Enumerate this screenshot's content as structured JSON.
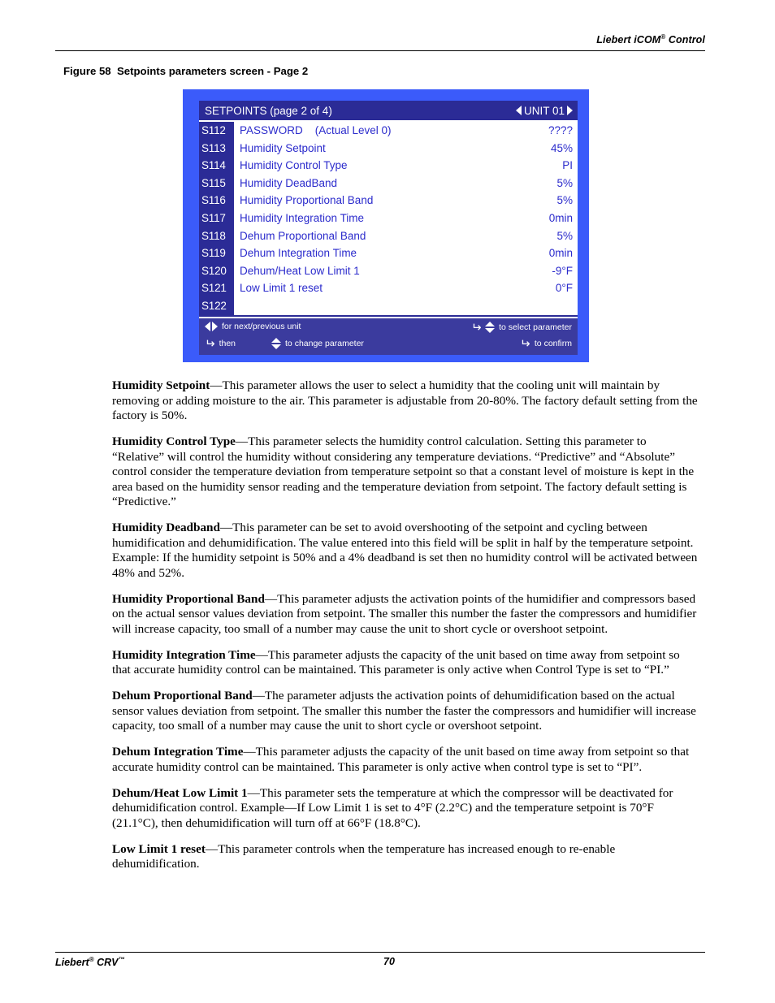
{
  "header": {
    "title_main": "Liebert iCOM",
    "title_sup": "®",
    "title_tail": " Control"
  },
  "figure": {
    "caption": "Figure 58  Setpoints parameters screen - Page 2"
  },
  "lcd": {
    "title": "SETPOINTS (page 2 of 4)",
    "unit_label": "UNIT 01",
    "nav_prev_icon": "triangle-left-icon",
    "nav_next_icon": "triangle-right-icon",
    "rows": [
      {
        "code": "S112",
        "label": "PASSWORD    (Actual Level 0)",
        "value": "????"
      },
      {
        "code": "S113",
        "label": "Humidity Setpoint",
        "value": "45%"
      },
      {
        "code": "S114",
        "label": "Humidity Control Type",
        "value": "PI"
      },
      {
        "code": "S115",
        "label": "Humidity DeadBand",
        "value": "5%"
      },
      {
        "code": "S116",
        "label": "Humidity Proportional Band",
        "value": "5%"
      },
      {
        "code": "S117",
        "label": "Humidity Integration Time",
        "value": "0min"
      },
      {
        "code": "S118",
        "label": "Dehum Proportional Band",
        "value": "5%"
      },
      {
        "code": "S119",
        "label": "Dehum Integration Time",
        "value": "0min"
      },
      {
        "code": "S120",
        "label": "Dehum/Heat Low Limit 1",
        "value": "-9°F"
      },
      {
        "code": "S121",
        "label": "Low Limit 1 reset",
        "value": "0°F"
      },
      {
        "code": "S122",
        "label": "",
        "value": ""
      }
    ],
    "hints": {
      "next_prev_unit": "for next/previous unit",
      "then": "then",
      "change_parameter": "to change parameter",
      "select_parameter": "to select parameter",
      "confirm": "to confirm"
    },
    "colors": {
      "panel_border": "#3b5bfa",
      "title_bar": "#2b2b96",
      "code_column": "#2b2b96",
      "row_background": "#ffffff",
      "row_text": "#2b2bcc",
      "hints_background": "#3b3b9e"
    }
  },
  "body": {
    "paragraphs": [
      {
        "term": "Humidity Setpoint",
        "text": "—This parameter allows the user to select a humidity that the cooling unit will maintain by removing or adding moisture to the air. This parameter is adjustable from 20-80%. The factory default setting from the factory is 50%."
      },
      {
        "term": "Humidity Control Type",
        "text": "—This parameter selects the humidity control calculation. Setting this parameter to “Relative” will control the humidity without considering any temperature deviations. “Predictive” and “Absolute” control consider the temperature deviation from temperature setpoint so that a constant level of moisture is kept in the area based on the humidity sensor reading and the temperature deviation from setpoint. The factory default setting is “Predictive.”"
      },
      {
        "term": "Humidity Deadband",
        "text": "—This parameter can be set to avoid overshooting of the setpoint and cycling between humidification and dehumidification. The value entered into this field will be split in half by the temperature setpoint. Example: If the humidity setpoint is 50% and a 4% deadband is set then no humidity control will be activated between 48% and 52%."
      },
      {
        "term": "Humidity Proportional Band",
        "text": "—This parameter adjusts the activation points of the humidifier and compressors based on the actual sensor values deviation from setpoint. The smaller this number the faster the compressors and humidifier will increase capacity, too small of a number may cause the unit to short cycle or overshoot setpoint."
      },
      {
        "term": "Humidity Integration Time",
        "text": "—This parameter adjusts the capacity of the unit based on time away from setpoint so that accurate humidity control can be maintained. This parameter is only active when Control Type is set to “PI.”"
      },
      {
        "term": "Dehum Proportional Band",
        "text": "—The parameter adjusts the activation points of dehumidification based on the actual sensor values deviation from setpoint. The smaller this number the faster the compressors and humidifier will increase capacity, too small of a number may cause the unit to short cycle or overshoot setpoint."
      },
      {
        "term": "Dehum Integration Time",
        "text": "—This parameter adjusts the capacity of the unit based on time away from setpoint so that accurate humidity control can be maintained. This parameter is only active when control type is set to “PI”."
      },
      {
        "term": "Dehum/Heat Low Limit 1",
        "text": "—This parameter sets the temperature at which the compressor will be deactivated for dehumidification control. Example—If Low Limit 1 is set to 4°F (2.2°C) and the temperature setpoint is 70°F (21.1°C), then dehumidification will turn off at 66°F (18.8°C)."
      },
      {
        "term": "Low Limit 1 reset",
        "text": "—This parameter controls when the temperature has increased enough to re-enable dehumidification."
      }
    ]
  },
  "footer": {
    "product_main": "Liebert",
    "product_sup1": "®",
    "product_mid": " CRV",
    "product_sup2": "™",
    "page_number": "70"
  }
}
